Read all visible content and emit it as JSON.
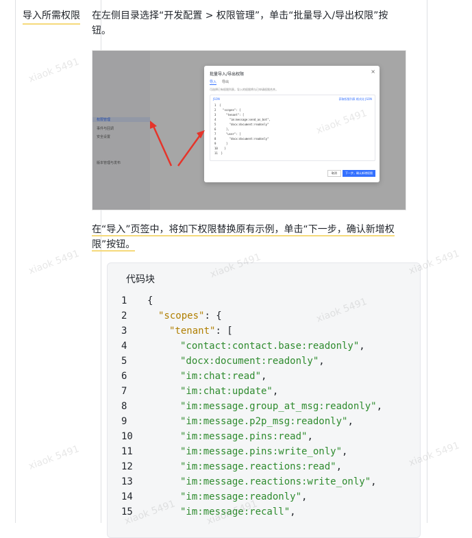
{
  "row": {
    "label": "导入所需权限",
    "step1": "在左侧目录选择“开发配置 > 权限管理”，单击“批量导入/导出权限”按钮。",
    "step2_a": "在“导入”页签中，将如下权限替换原有示例，单击“下一步，确认新增权",
    "step2_b": "限”按钮。"
  },
  "screenshot": {
    "sidebar_items": [
      "权限管理",
      "事件与回调",
      "安全设置",
      "版本管理与发布"
    ],
    "modal_title": "批量导入/导出权限",
    "tab_import": "导入",
    "tab_export": "导出",
    "note": "可选择已有权限列表，导入的权限将与已申请权限合并。",
    "code_head": "JSON",
    "code_head_right": "获取权限列表 格式化 JSON",
    "code_lines": [
      "{",
      "  \"scopes\": {",
      "    \"tenant\": [",
      "      \"im:message:send_as_bot\",",
      "      \"docx:document:readonly\"",
      "    ],",
      "    \"user\": [",
      "      \"docx:document:readonly\"",
      "    ]",
      "  }",
      "}"
    ],
    "btn_cancel": "取消",
    "btn_next": "下一步，确认新增权限"
  },
  "codeblock": {
    "title": "代码块",
    "lines": [
      {
        "n": "1",
        "indent": 0,
        "text": "{"
      },
      {
        "n": "2",
        "indent": 1,
        "key": "\"scopes\"",
        "text": ": {"
      },
      {
        "n": "3",
        "indent": 2,
        "key": "\"tenant\"",
        "text": ": ["
      },
      {
        "n": "4",
        "indent": 3,
        "str": "\"contact:contact.base:readonly\"",
        "text": ","
      },
      {
        "n": "5",
        "indent": 3,
        "str": "\"docx:document:readonly\"",
        "text": ","
      },
      {
        "n": "6",
        "indent": 3,
        "str": "\"im:chat:read\"",
        "text": ","
      },
      {
        "n": "7",
        "indent": 3,
        "str": "\"im:chat:update\"",
        "text": ","
      },
      {
        "n": "8",
        "indent": 3,
        "str": "\"im:message.group_at_msg:readonly\"",
        "text": ","
      },
      {
        "n": "9",
        "indent": 3,
        "str": "\"im:message.p2p_msg:readonly\"",
        "text": ","
      },
      {
        "n": "10",
        "indent": 3,
        "str": "\"im:message.pins:read\"",
        "text": ","
      },
      {
        "n": "11",
        "indent": 3,
        "str": "\"im:message.pins:write_only\"",
        "text": ","
      },
      {
        "n": "12",
        "indent": 3,
        "str": "\"im:message.reactions:read\"",
        "text": ","
      },
      {
        "n": "13",
        "indent": 3,
        "str": "\"im:message.reactions:write_only\"",
        "text": ","
      },
      {
        "n": "14",
        "indent": 3,
        "str": "\"im:message:readonly\"",
        "text": ","
      },
      {
        "n": "15",
        "indent": 3,
        "str": "\"im:message:recall\"",
        "text": ","
      }
    ]
  },
  "watermark": "xiaok 5491"
}
